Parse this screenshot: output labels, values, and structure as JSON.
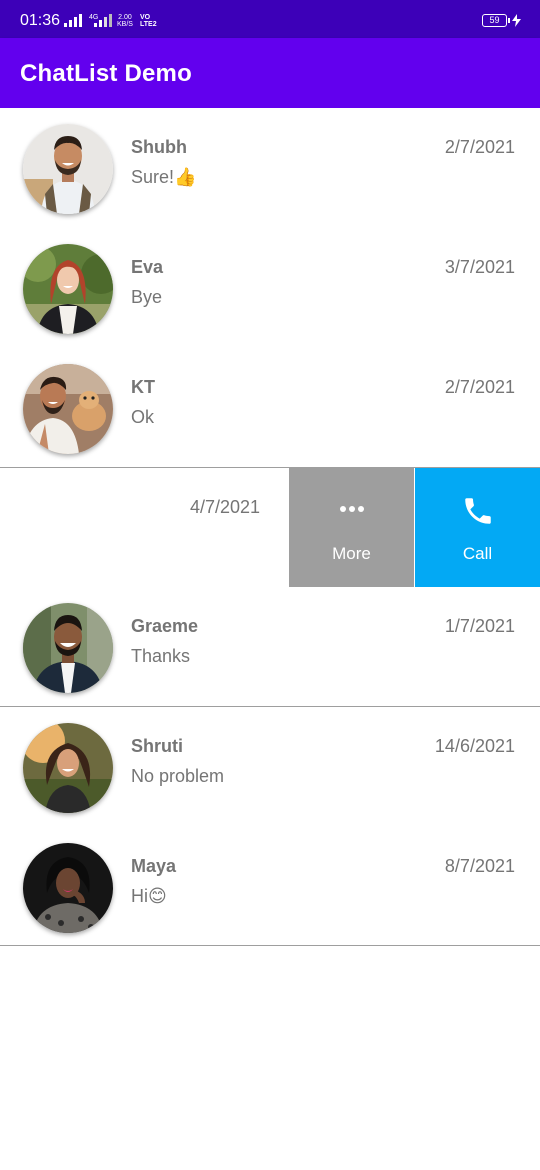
{
  "status_bar": {
    "time": "01:36",
    "network_a": "4G",
    "speed_value": "2.00",
    "speed_unit": "KB/S",
    "volte_top": "VO",
    "volte_bottom": "LTE2",
    "battery": "59"
  },
  "app_bar": {
    "title": "ChatList Demo",
    "color": "#6200ee"
  },
  "chats": [
    {
      "name": "Shubh",
      "message": "Sure!👍",
      "date": "2/7/2021",
      "avatar": "avatar-shubh"
    },
    {
      "name": "Eva",
      "message": "Bye",
      "date": "3/7/2021",
      "avatar": "avatar-eva"
    },
    {
      "name": "KT",
      "message": "Ok",
      "date": "2/7/2021",
      "avatar": "avatar-kt"
    },
    {
      "name": "Graeme",
      "message": "Thanks",
      "date": "1/7/2021",
      "avatar": "avatar-graeme"
    },
    {
      "name": "Shruti",
      "message": "No problem",
      "date": "14/6/2021",
      "avatar": "avatar-shruti"
    },
    {
      "name": "Maya",
      "message": "Hi😊",
      "date": "8/7/2021",
      "avatar": "avatar-maya"
    }
  ],
  "swiped_row": {
    "date": "4/7/2021",
    "more_label": "More",
    "call_label": "Call",
    "more_icon": "more-horiz-icon",
    "call_icon": "phone-icon",
    "more_color": "#9e9e9e",
    "call_color": "#03a9f4"
  }
}
